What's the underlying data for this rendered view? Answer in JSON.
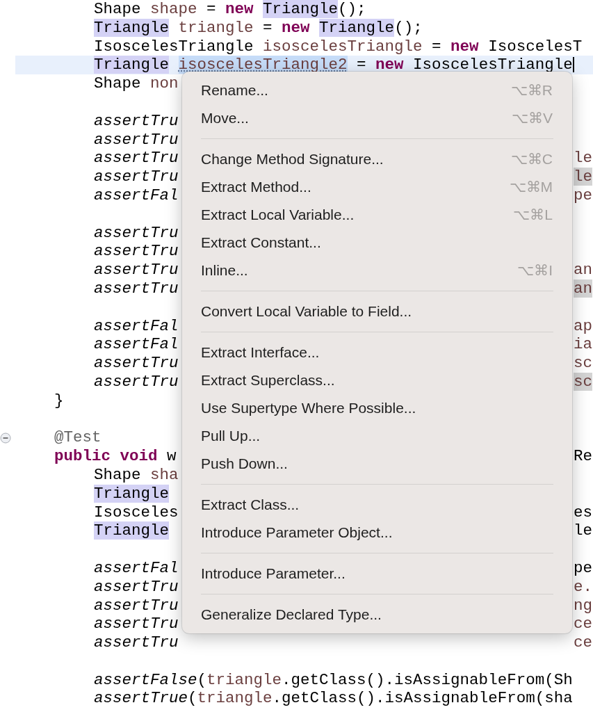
{
  "editor": {
    "blocks": [
      {
        "lines": [
          {
            "kind": "body",
            "segments": [
              {
                "text": "Shape ",
                "kind": "plain"
              },
              {
                "text": "shape",
                "kind": "variable"
              },
              {
                "text": " = ",
                "kind": "plain"
              },
              {
                "text": "new ",
                "kind": "keyword"
              },
              {
                "text": "Triangle",
                "kind": "type_highlight"
              },
              {
                "text": "();",
                "kind": "plain"
              }
            ]
          },
          {
            "kind": "body",
            "segments": [
              {
                "text": "Triangle",
                "kind": "type_highlight"
              },
              {
                "text": " triangle",
                "kind": "variable"
              },
              {
                "text": " = ",
                "kind": "plain"
              },
              {
                "text": "new ",
                "kind": "keyword"
              },
              {
                "text": "Triangle",
                "kind": "type_highlight"
              },
              {
                "text": "();",
                "kind": "plain"
              }
            ]
          },
          {
            "kind": "body",
            "segments": [
              {
                "text": "IsoscelesTriangle ",
                "kind": "plain"
              },
              {
                "text": "isoscelesTriangle",
                "kind": "variable"
              },
              {
                "text": " = ",
                "kind": "plain"
              },
              {
                "text": "new",
                "kind": "keyword"
              },
              {
                "text": " IsoscelesT",
                "kind": "plain"
              }
            ]
          },
          {
            "kind": "body",
            "current": true,
            "segments": [
              {
                "text": "Triangle",
                "kind": "type_highlight"
              },
              {
                "text": "isoscelesTriangle2",
                "kind": "selected"
              },
              {
                "text": " = ",
                "kind": "plain"
              },
              {
                "text": "new",
                "kind": "keyword"
              },
              {
                "text": " IsoscelesTriangle",
                "kind": "plain"
              }
            ]
          },
          {
            "kind": "body",
            "segments": [
              {
                "text": "Shape ",
                "kind": "plain"
              },
              {
                "text": "non",
                "kind": "variable"
              }
            ]
          }
        ]
      },
      {
        "lines": [
          {
            "kind": "body",
            "segments": [
              {
                "text": "assertTru",
                "kind": "italic"
              }
            ]
          },
          {
            "kind": "body",
            "segments": [
              {
                "text": "assertTru",
                "kind": "italic"
              }
            ]
          },
          {
            "kind": "body",
            "segments": [
              {
                "text": "assertTru",
                "kind": "italic"
              }
            ],
            "right": [
              {
                "text": "le",
                "kind": "variable"
              }
            ]
          },
          {
            "kind": "body",
            "segments": [
              {
                "text": "assertTru",
                "kind": "italic"
              }
            ],
            "right": [
              {
                "text": "le",
                "kind": "occurrence"
              }
            ]
          },
          {
            "kind": "body",
            "segments": [
              {
                "text": "assertFal",
                "kind": "italic"
              }
            ],
            "right": [
              {
                "text": "pe",
                "kind": "variable"
              }
            ]
          }
        ]
      },
      {
        "lines": [
          {
            "kind": "body",
            "segments": [
              {
                "text": "assertTru",
                "kind": "italic"
              }
            ]
          },
          {
            "kind": "body",
            "segments": [
              {
                "text": "assertTru",
                "kind": "italic"
              }
            ]
          },
          {
            "kind": "body",
            "segments": [
              {
                "text": "assertTru",
                "kind": "italic"
              }
            ],
            "right": [
              {
                "text": "an",
                "kind": "variable"
              }
            ]
          },
          {
            "kind": "body",
            "segments": [
              {
                "text": "assertTru",
                "kind": "italic"
              }
            ],
            "right": [
              {
                "text": "an",
                "kind": "occurrence"
              }
            ]
          }
        ]
      },
      {
        "lines": [
          {
            "kind": "body",
            "segments": [
              {
                "text": "assertFal",
                "kind": "italic"
              }
            ],
            "right": [
              {
                "text": "ap",
                "kind": "variable"
              }
            ]
          },
          {
            "kind": "body",
            "segments": [
              {
                "text": "assertFal",
                "kind": "italic"
              }
            ],
            "right": [
              {
                "text": "ia",
                "kind": "variable"
              }
            ]
          },
          {
            "kind": "body",
            "segments": [
              {
                "text": "assertTru",
                "kind": "italic"
              }
            ],
            "right": [
              {
                "text": "sc",
                "kind": "variable"
              }
            ]
          },
          {
            "kind": "body",
            "segments": [
              {
                "text": "assertTru",
                "kind": "italic"
              }
            ],
            "right": [
              {
                "text": "sc",
                "kind": "occurrence"
              }
            ]
          },
          {
            "kind": "method",
            "segments": [
              {
                "text": "}",
                "kind": "plain"
              }
            ]
          }
        ]
      },
      {
        "lines": [
          {
            "kind": "method",
            "expanded": true,
            "segments": [
              {
                "text": "@Test",
                "kind": "annotation"
              }
            ]
          },
          {
            "kind": "method",
            "segments": [
              {
                "text": "public ",
                "kind": "keyword"
              },
              {
                "text": "void",
                "kind": "keyword"
              },
              {
                "text": " w",
                "kind": "plain"
              }
            ],
            "right": [
              {
                "text": "Re",
                "kind": "plain"
              }
            ]
          },
          {
            "kind": "body",
            "segments": [
              {
                "text": "Shape ",
                "kind": "plain"
              },
              {
                "text": "sha",
                "kind": "variable"
              }
            ]
          },
          {
            "kind": "body",
            "segments": [
              {
                "text": "Triangle",
                "kind": "type_highlight"
              }
            ]
          },
          {
            "kind": "body",
            "segments": [
              {
                "text": "Isosceles",
                "kind": "plain"
              }
            ],
            "right": [
              {
                "text": "es",
                "kind": "plain"
              }
            ]
          },
          {
            "kind": "body",
            "segments": [
              {
                "text": "Triangle",
                "kind": "type_highlight"
              }
            ],
            "right": [
              {
                "text": "le",
                "kind": "plain"
              }
            ]
          }
        ]
      },
      {
        "lines": [
          {
            "kind": "body",
            "segments": [
              {
                "text": "assertFal",
                "kind": "italic"
              }
            ],
            "right": [
              {
                "text": "pe",
                "kind": "plain"
              }
            ]
          },
          {
            "kind": "body",
            "segments": [
              {
                "text": "assertTru",
                "kind": "italic"
              }
            ],
            "right": [
              {
                "text": "e.",
                "kind": "variable"
              }
            ]
          },
          {
            "kind": "body",
            "segments": [
              {
                "text": "assertTru",
                "kind": "italic"
              }
            ],
            "right": [
              {
                "text": "ng",
                "kind": "variable"
              }
            ]
          },
          {
            "kind": "body",
            "segments": [
              {
                "text": "assertTru",
                "kind": "italic"
              }
            ],
            "right": [
              {
                "text": "ce",
                "kind": "variable"
              }
            ]
          },
          {
            "kind": "body",
            "segments": [
              {
                "text": "assertTru",
                "kind": "italic"
              }
            ],
            "right": [
              {
                "text": "ce",
                "kind": "variable"
              }
            ]
          }
        ]
      },
      {
        "lines": [
          {
            "kind": "body",
            "segments": [
              {
                "text": "assertFalse",
                "kind": "italic"
              },
              {
                "text": "(",
                "kind": "plain"
              },
              {
                "text": "triangle",
                "kind": "variable"
              },
              {
                "text": ".getClass().isAssignableFrom(Sh",
                "kind": "plain"
              }
            ]
          },
          {
            "kind": "body",
            "segments": [
              {
                "text": "assertTrue",
                "kind": "italic"
              },
              {
                "text": "(",
                "kind": "plain"
              },
              {
                "text": "triangle",
                "kind": "variable"
              },
              {
                "text": ".getClass().isAssignableFrom(sha",
                "kind": "plain"
              }
            ]
          }
        ]
      }
    ]
  },
  "context_menu": {
    "groups": [
      [
        {
          "label": "Rename...",
          "shortcut": "⌥⌘R"
        },
        {
          "label": "Move...",
          "shortcut": "⌥⌘V"
        }
      ],
      [
        {
          "label": "Change Method Signature...",
          "shortcut": "⌥⌘C"
        },
        {
          "label": "Extract Method...",
          "shortcut": "⌥⌘M"
        },
        {
          "label": "Extract Local Variable...",
          "shortcut": "⌥⌘L"
        },
        {
          "label": "Extract Constant..."
        },
        {
          "label": "Inline...",
          "shortcut": "⌥⌘I"
        }
      ],
      [
        {
          "label": "Convert Local Variable to Field..."
        }
      ],
      [
        {
          "label": "Extract Interface..."
        },
        {
          "label": "Extract Superclass..."
        },
        {
          "label": "Use Supertype Where Possible..."
        },
        {
          "label": "Pull Up..."
        },
        {
          "label": "Push Down..."
        }
      ],
      [
        {
          "label": "Extract Class..."
        },
        {
          "label": "Introduce Parameter Object..."
        }
      ],
      [
        {
          "label": "Introduce Parameter..."
        }
      ],
      [
        {
          "label": "Generalize Declared Type..."
        }
      ]
    ]
  }
}
